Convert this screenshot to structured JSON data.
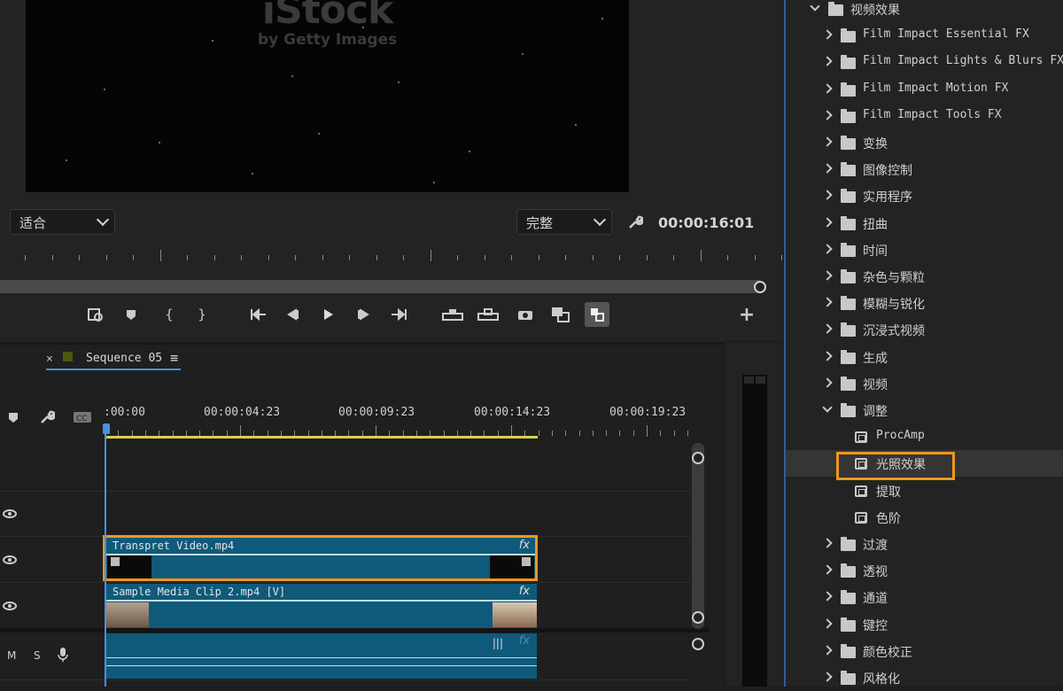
{
  "monitor": {
    "watermark_main": "iStock",
    "watermark_sub": "by Getty Images",
    "zoom_select": "适合",
    "quality_select": "完整",
    "timecode": "00:00:16:01",
    "icons": [
      "export-frame-icon",
      "marker-icon",
      "mark-in-icon",
      "mark-out-icon",
      "go-to-in-icon",
      "step-back-icon",
      "play-icon",
      "step-forward-icon",
      "go-to-out-icon",
      "lift-icon",
      "extract-icon",
      "camera-icon",
      "compare-view-icon",
      "comparison-toggle-icon",
      "add-button-icon"
    ]
  },
  "timeline": {
    "sequence_tab": "Sequence 05",
    "close_glyph": "×",
    "menu_glyph": "≡",
    "ruler_labels": [
      ":00:00",
      "00:00:04:23",
      "00:00:09:23",
      "00:00:14:23",
      "00:00:19:23"
    ],
    "clips": [
      {
        "name": "Transpret Video.mp4",
        "fx": "fx"
      },
      {
        "name": "Sample Media Clip 2.mp4 [V]",
        "fx": "fx"
      },
      {
        "name": "",
        "fx": "fx"
      }
    ],
    "audio_labels": {
      "mute": "M",
      "solo": "S"
    }
  },
  "effects": {
    "root": "视频效果",
    "items": [
      {
        "label": "Film Impact Essential FX",
        "mono": true
      },
      {
        "label": "Film Impact Lights & Blurs FX",
        "mono": true
      },
      {
        "label": "Film Impact Motion FX",
        "mono": true
      },
      {
        "label": "Film Impact Tools FX",
        "mono": true
      },
      {
        "label": "变换"
      },
      {
        "label": "图像控制"
      },
      {
        "label": "实用程序"
      },
      {
        "label": "扭曲"
      },
      {
        "label": "时间"
      },
      {
        "label": "杂色与颗粒"
      },
      {
        "label": "模糊与锐化"
      },
      {
        "label": "沉浸式视频"
      },
      {
        "label": "生成"
      },
      {
        "label": "视频"
      }
    ],
    "expanded": "调整",
    "sub_items": [
      "ProcAmp",
      "光照效果",
      "提取",
      "色阶"
    ],
    "after_items": [
      "过渡",
      "透视",
      "通道",
      "键控",
      "颜色校正",
      "风格化"
    ]
  },
  "colors": {
    "highlight": "#f0961e",
    "clip": "#0f5a7a",
    "playhead": "#4a90e2"
  }
}
